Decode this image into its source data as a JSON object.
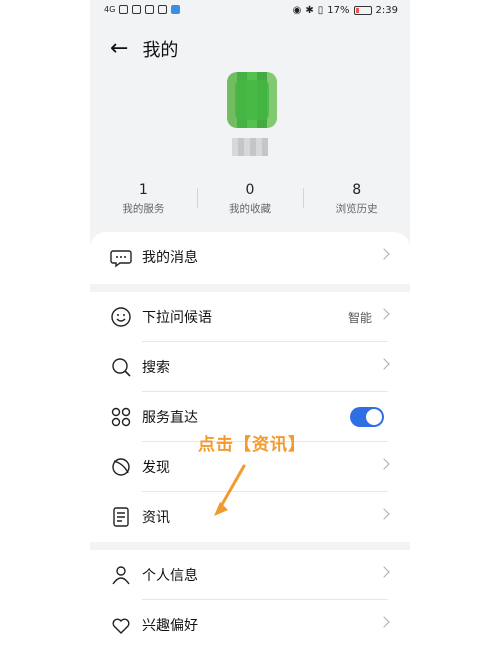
{
  "statusbar": {
    "network_text": "4G",
    "battery_percent": "17%",
    "time": "2:39"
  },
  "header": {
    "title": "我的"
  },
  "stats": [
    {
      "value": "1",
      "label": "我的服务"
    },
    {
      "value": "0",
      "label": "我的收藏"
    },
    {
      "value": "8",
      "label": "浏览历史"
    }
  ],
  "menu": {
    "messages": "我的消息",
    "pulldown_greeting": "下拉问候语",
    "pulldown_greeting_value": "智能",
    "search": "搜索",
    "service_direct": "服务直达",
    "service_direct_on": true,
    "discover": "发现",
    "news": "资讯",
    "personal_info": "个人信息",
    "interests": "兴趣偏好"
  },
  "annotation": {
    "text": "点击【资讯】",
    "color": "#f29a2e"
  },
  "colors": {
    "toggle_on": "#2e6fe4",
    "background": "#f1f3f5"
  }
}
